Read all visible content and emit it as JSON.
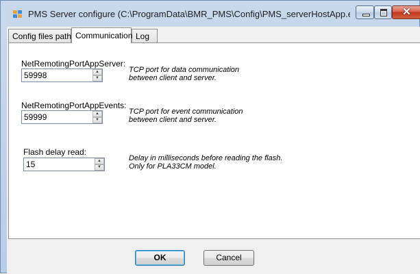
{
  "window": {
    "title": "PMS Server configure (C:\\ProgramData\\BMR_PMS\\Config\\PMS_serverHostApp.exe.conf...",
    "icon": "app-icon",
    "controls": {
      "minimize": "minimize-icon",
      "maximize": "maximize-icon",
      "close": "✕"
    }
  },
  "tabs": [
    {
      "label": "Config files path",
      "active": false
    },
    {
      "label": "Communication",
      "active": true
    },
    {
      "label": "Log",
      "active": false
    }
  ],
  "fields": [
    {
      "label": "NetRemotingPortAppServer:",
      "value": "59998",
      "description": [
        "TCP port for data communication",
        "between client and server."
      ]
    },
    {
      "label": "NetRemotingPortAppEvents:",
      "value": "59999",
      "description": [
        "TCP port for event communication",
        "between client and server."
      ]
    },
    {
      "label": "Flash delay read:",
      "value": "15",
      "description": [
        "Delay in milliseconds before reading the flash.",
        "Only for PLA33CM model."
      ]
    }
  ],
  "buttons": {
    "ok": "OK",
    "cancel": "Cancel"
  },
  "colors": {
    "accent": "#48b5e8",
    "close_button": "#c3371f",
    "titlebar": "#c9d9ec"
  }
}
